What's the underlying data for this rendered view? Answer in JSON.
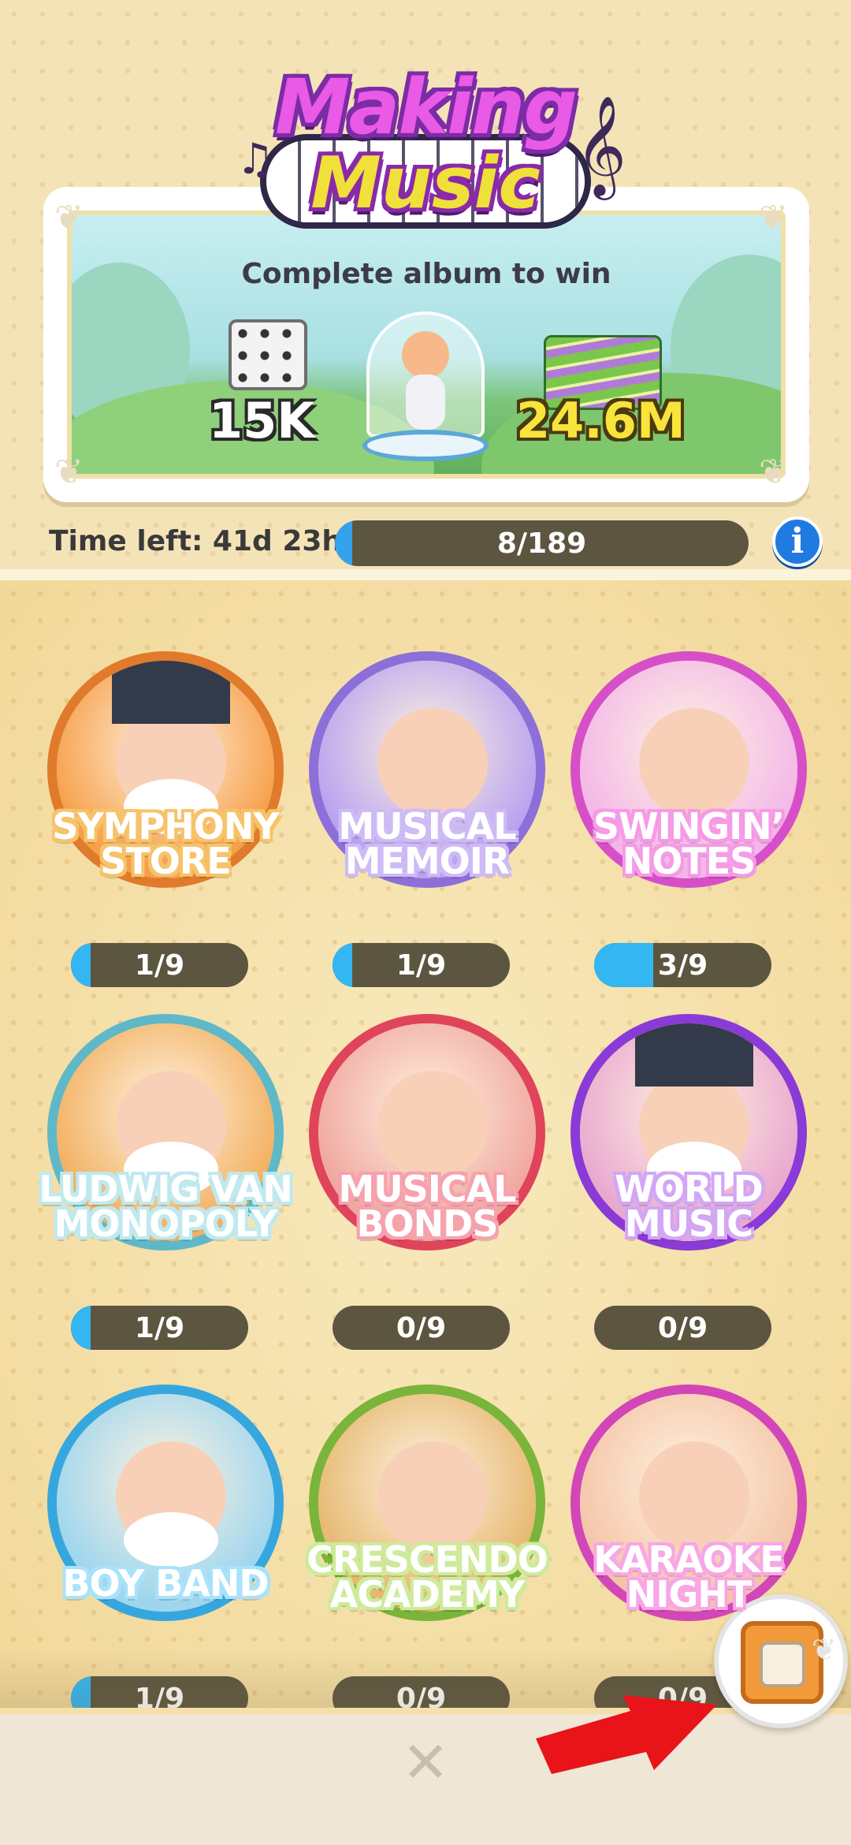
{
  "event": {
    "logo_line1": "Making",
    "logo_line2": "Music",
    "prize_title": "Complete album to win",
    "reward_dice": "15K",
    "reward_cash": "24.6M",
    "time_left": "Time left: 41d 23h",
    "progress_text": "8/189",
    "progress_fraction": 0.042,
    "info_icon": "i"
  },
  "sets": [
    {
      "title_line1": "SYMPHONY",
      "title_line2": "STORE",
      "progress_text": "1/9",
      "progress_fraction": 0.111,
      "ring": "#e07b2b",
      "bg": "#f6a04a",
      "title_color": "#f6c36a"
    },
    {
      "title_line1": "MUSICAL",
      "title_line2": "MEMOIR",
      "progress_text": "1/9",
      "progress_fraction": 0.111,
      "ring": "#8c6fd8",
      "bg": "#b9a2ef",
      "title_color": "#cdbaf6"
    },
    {
      "title_line1": "SWINGIN’",
      "title_line2": "NOTES",
      "progress_text": "3/9",
      "progress_fraction": 0.333,
      "ring": "#d64fc8",
      "bg": "#f3b6e9",
      "title_color": "#f59be6"
    },
    {
      "title_line1": "LUDWIG VAN",
      "title_line2": "MONOPOLY",
      "progress_text": "1/9",
      "progress_fraction": 0.111,
      "ring": "#5fb8c8",
      "bg": "#f2b060",
      "title_color": "#bfe9ef"
    },
    {
      "title_line1": "MUSICAL",
      "title_line2": "BONDS",
      "progress_text": "0/9",
      "progress_fraction": 0,
      "ring": "#e0445a",
      "bg": "#f0a7a0",
      "title_color": "#f6a2ae"
    },
    {
      "title_line1": "WORLD",
      "title_line2": "MUSIC",
      "progress_text": "0/9",
      "progress_fraction": 0,
      "ring": "#8a3ad6",
      "bg": "#e9a9cf",
      "title_color": "#d2a6f5"
    },
    {
      "title_line1": "BOY BAND",
      "title_line2": "",
      "progress_text": "1/9",
      "progress_fraction": 0.111,
      "ring": "#36a7de",
      "bg": "#9fd6ee",
      "title_color": "#a9e2fb"
    },
    {
      "title_line1": "CRESCENDO",
      "title_line2": "ACADEMY",
      "progress_text": "0/9",
      "progress_fraction": 0,
      "ring": "#7bb43a",
      "bg": "#e6b870",
      "title_color": "#cdeb9a"
    },
    {
      "title_line1": "KARAOKE",
      "title_line2": "NIGHT",
      "progress_text": "0/9",
      "progress_fraction": 0,
      "ring": "#d346b8",
      "bg": "#f4c5a8",
      "title_color": "#f8a6e6"
    }
  ],
  "bottom": {
    "close_icon": "✕"
  },
  "icons": {
    "close": "close-icon",
    "info": "info-icon",
    "vault": "vault-icon",
    "arrow": "red-arrow-icon"
  },
  "colors": {
    "progress_fill": "#34b6f2",
    "progress_track": "#5c5640",
    "info_blue": "#1f7be0",
    "arrow_red": "#e8141a"
  }
}
